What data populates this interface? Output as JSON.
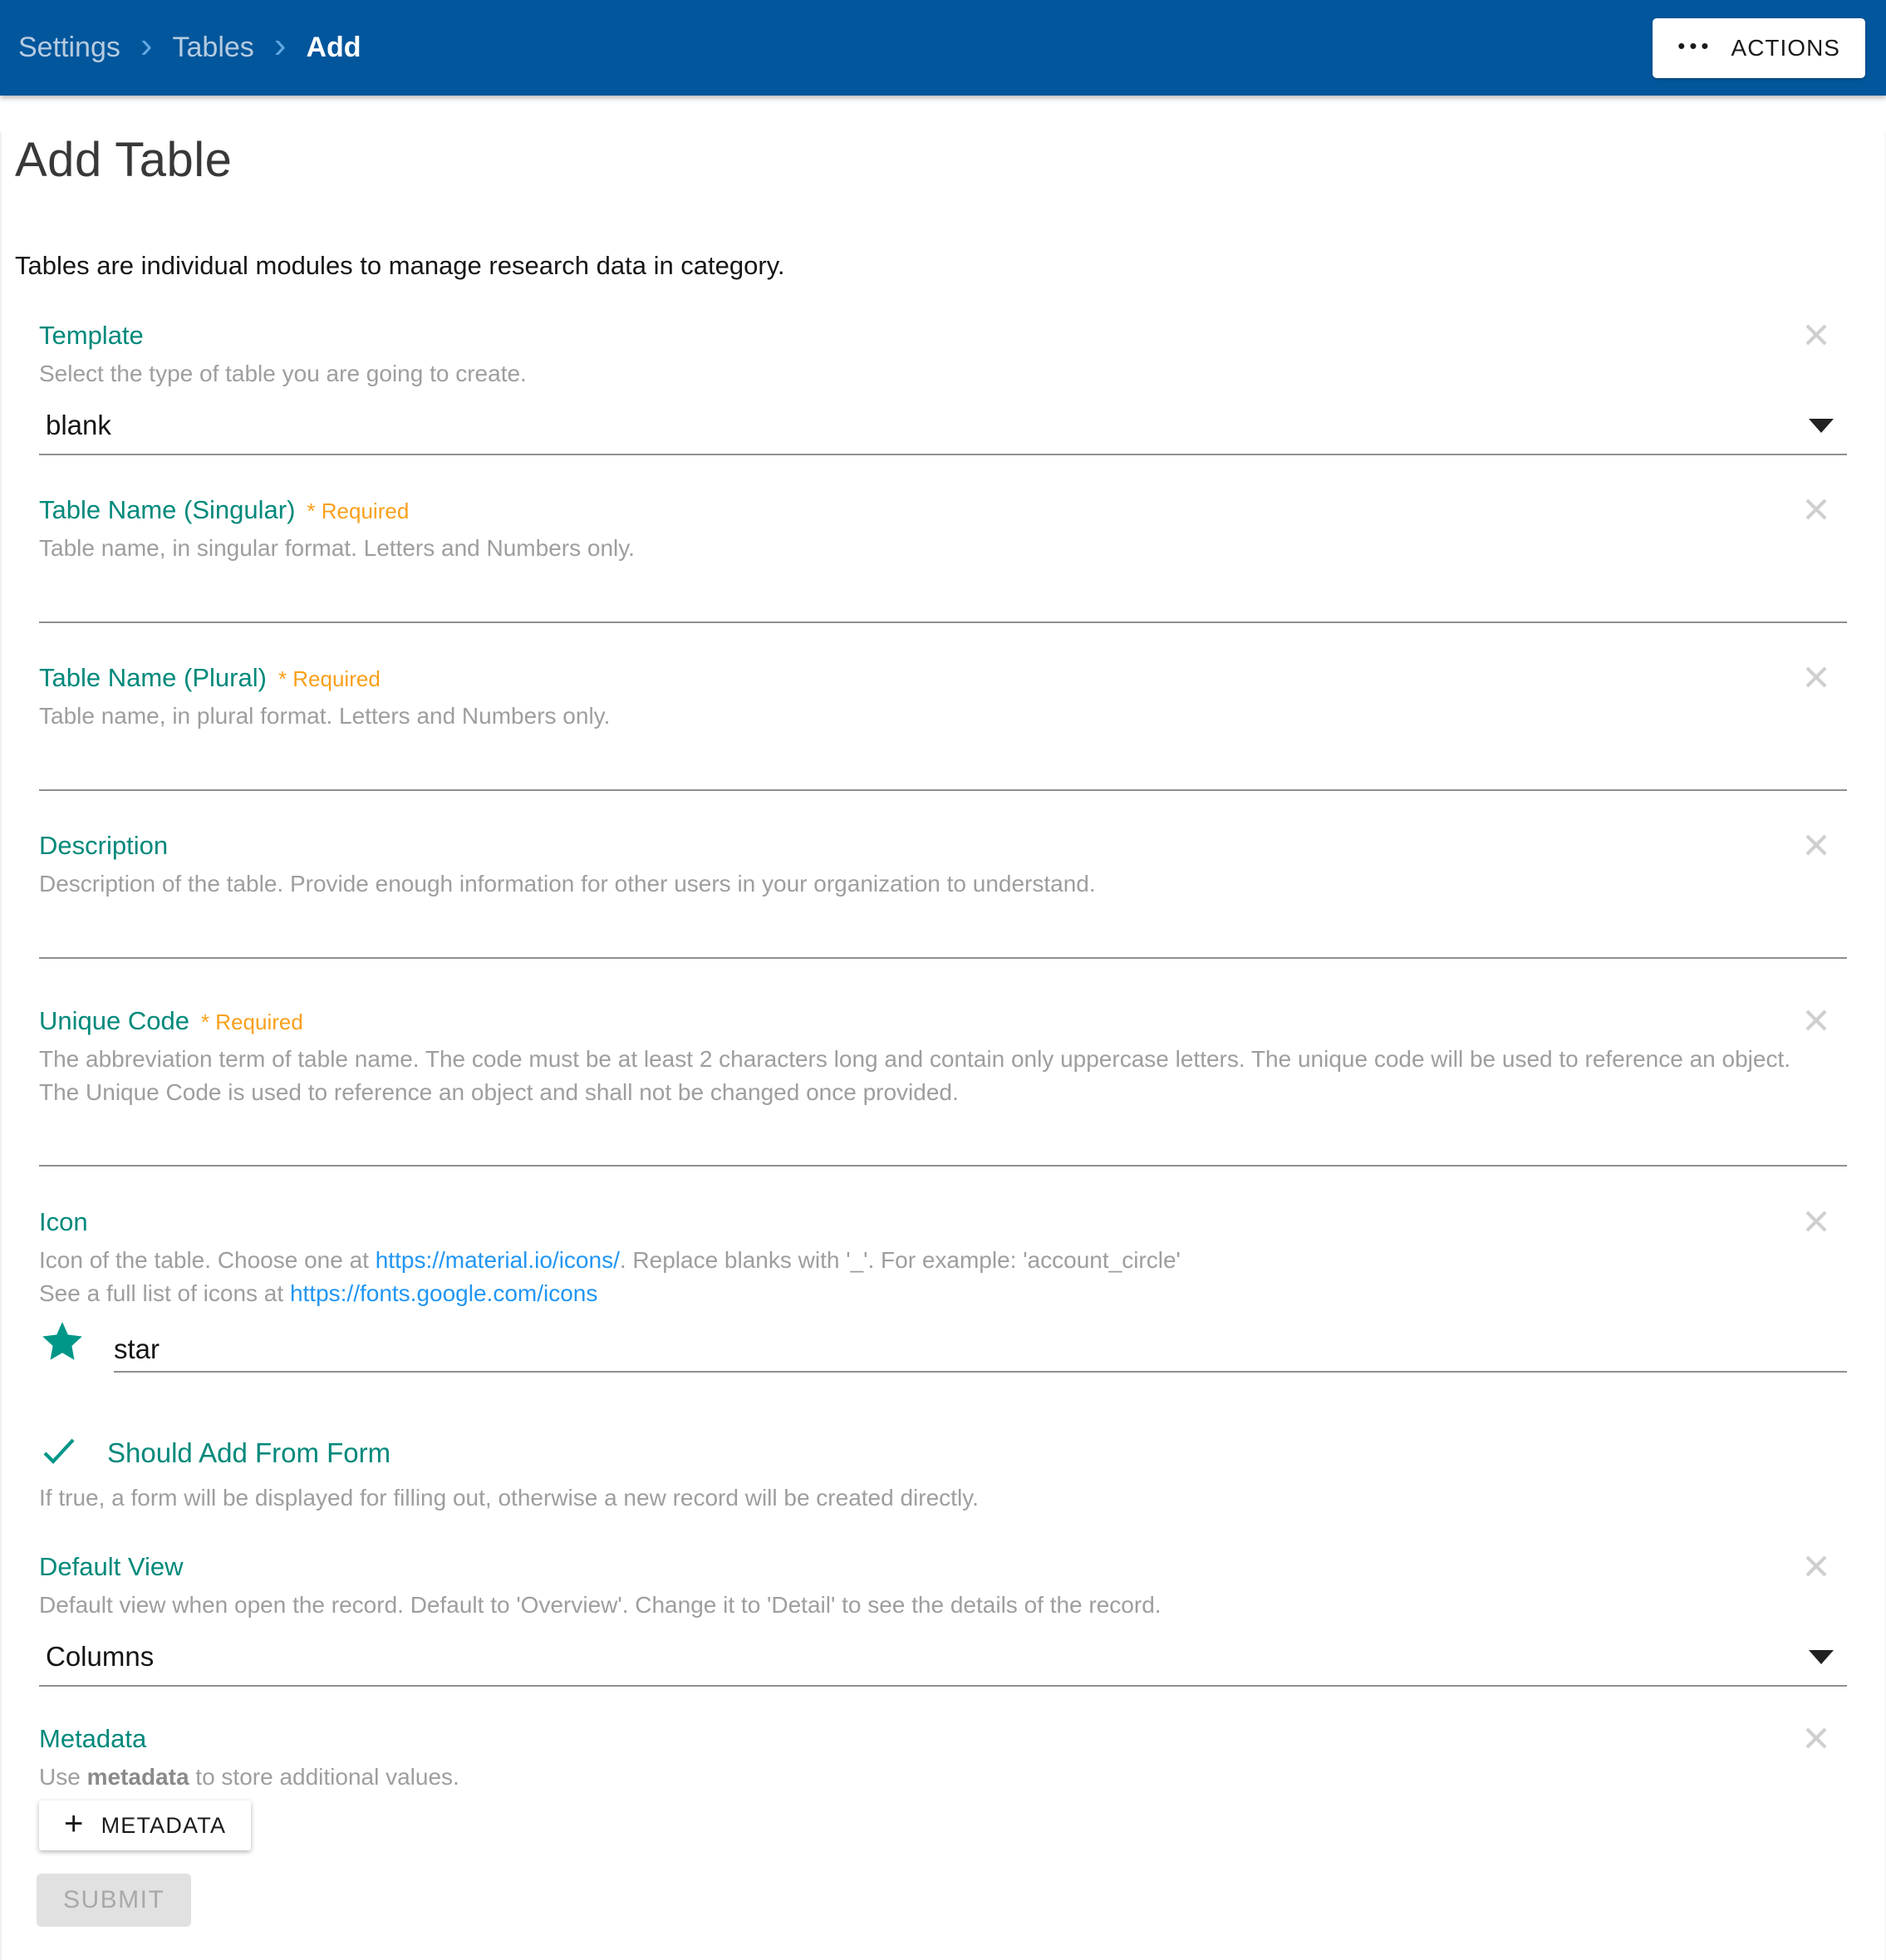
{
  "header": {
    "breadcrumbs": [
      {
        "label": "Settings"
      },
      {
        "label": "Tables"
      },
      {
        "label": "Add"
      }
    ],
    "actions_button": {
      "dots": "•••",
      "label": "ACTIONS"
    }
  },
  "page": {
    "title": "Add Table",
    "intro": "Tables are individual modules to manage research data in category."
  },
  "colors": {
    "header_blue": "#01569C",
    "label_teal": "#00897B",
    "required_orange": "#F9A01B",
    "link_blue": "#2196F3",
    "star_teal": "#009688"
  },
  "fields": {
    "template": {
      "label": "Template",
      "help": "Select the type of table you are going to create.",
      "value": "blank"
    },
    "singular": {
      "label": "Table Name (Singular)",
      "required": "* Required",
      "help": "Table name, in singular format. Letters and Numbers only.",
      "value": ""
    },
    "plural": {
      "label": "Table Name (Plural)",
      "required": "* Required",
      "help": "Table name, in plural format. Letters and Numbers only.",
      "value": ""
    },
    "description": {
      "label": "Description",
      "help": "Description of the table. Provide enough information for other users in your organization to understand.",
      "value": ""
    },
    "unique_code": {
      "label": "Unique Code",
      "required": "* Required",
      "help": "The abbreviation term of table name. The code must be at least 2 characters long and contain only uppercase letters. The unique code will be used to reference an object. The Unique Code is used to reference an object and shall not be changed once provided.",
      "value": ""
    },
    "icon": {
      "label": "Icon",
      "help1_prefix": "Icon of the table. Choose one at ",
      "help1_link": "https://material.io/icons/",
      "help1_suffix": ". Replace blanks with '_'. For example: 'account_circle'",
      "help2_prefix": "See a full list of icons at ",
      "help2_link": "https://fonts.google.com/icons",
      "value": "star"
    },
    "should_add_from_form": {
      "label": "Should Add From Form",
      "help": "If true, a form will be displayed for filling out, otherwise a new record will be created directly.",
      "checked": true
    },
    "default_view": {
      "label": "Default View",
      "help": "Default view when open the record. Default to 'Overview'. Change it to 'Detail' to see the details of the record.",
      "value": "Columns"
    },
    "metadata": {
      "label": "Metadata",
      "help_prefix": "Use ",
      "help_bold": "metadata",
      "help_suffix": " to store additional values.",
      "add_button": {
        "plus": "+",
        "label": "METADATA"
      }
    }
  },
  "footer": {
    "submit_label": "SUBMIT"
  }
}
